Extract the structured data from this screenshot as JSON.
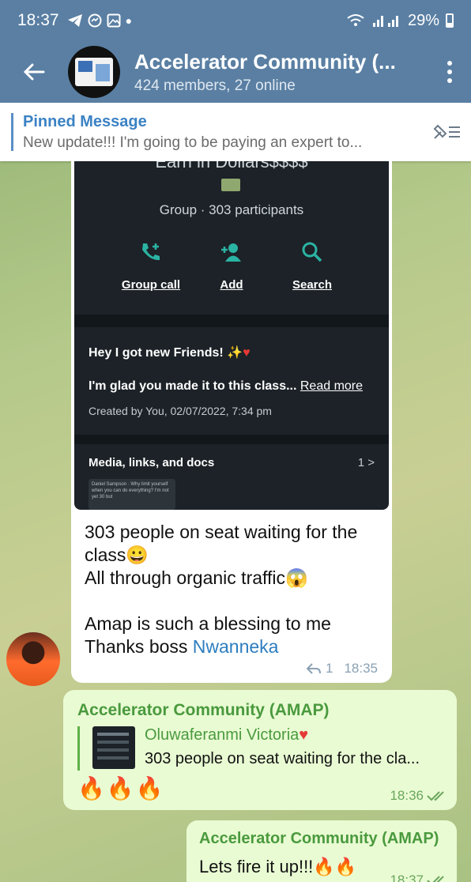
{
  "status": {
    "time": "18:37",
    "battery": "29%"
  },
  "header": {
    "title": "Accelerator Community (...",
    "subtitle": "424 members, 27 online"
  },
  "pinned": {
    "title": "Pinned Message",
    "text": "New update!!!  I'm going to be paying an expert to..."
  },
  "shared_screenshot": {
    "cut_title": "Earn in Dollars$$$$",
    "group_info": "Group · 303 participants",
    "actions": [
      "Group call",
      "Add",
      "Search"
    ],
    "description_title": "Hey I got new Friends!",
    "description_line": "I'm glad you made it to this class...",
    "read_more": "Read more",
    "created": "Created by You, 02/07/2022, 7:34 pm",
    "media_label": "Media, links, and docs",
    "media_count": "1 >",
    "thumb_text": "Daniel Sampson · Why limit yourself when you can do everything? I'm not yet 30 but"
  },
  "message_main": {
    "lines": [
      "303 people on seat waiting for the",
      "class😀",
      "All through organic traffic😱",
      "",
      "Amap is such a blessing to me"
    ],
    "last_line_prefix": "Thanks boss ",
    "mention": "Nwanneka",
    "reply_count": "1",
    "time": "18:35"
  },
  "message_reply": {
    "sender": "Accelerator Community (AMAP)",
    "quoted_name": "Oluwaferanmi Victoria",
    "quoted_text": "303 people on seat waiting for the cla...",
    "text": "🔥🔥🔥",
    "time": "18:36"
  },
  "message_last": {
    "sender": "Accelerator Community (AMAP)",
    "text": "Lets fire it up!!!🔥🔥",
    "time": "18:37"
  }
}
